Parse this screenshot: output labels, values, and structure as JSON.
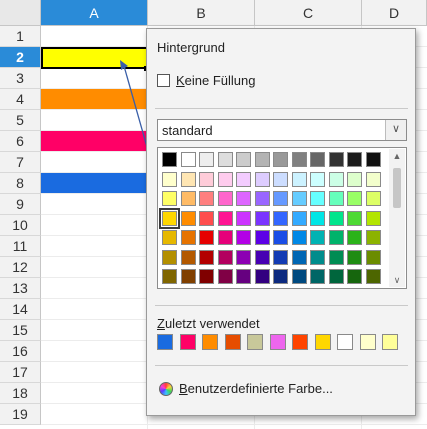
{
  "columns": [
    {
      "label": "A",
      "selected": true
    },
    {
      "label": "B",
      "selected": false
    },
    {
      "label": "C",
      "selected": false
    },
    {
      "label": "D",
      "selected": false
    }
  ],
  "rows": [
    "1",
    "2",
    "3",
    "4",
    "5",
    "6",
    "7",
    "8",
    "9",
    "10",
    "11",
    "12",
    "13",
    "14",
    "15",
    "16",
    "17",
    "18",
    "19"
  ],
  "selected_row": "2",
  "cell_fills": [
    {
      "row": "2",
      "color": "#ffff00"
    },
    {
      "row": "4",
      "color": "#ff8c00"
    },
    {
      "row": "6",
      "color": "#ff0066"
    },
    {
      "row": "8",
      "color": "#1a6be0"
    }
  ],
  "popup": {
    "title": "Hintergrund",
    "no_fill": {
      "accesskey": "K",
      "rest": "eine Füllung"
    },
    "palette_name": "standard",
    "palette_colors": [
      [
        "#000000",
        "#ffffff",
        "#eeeeee",
        "#dddddd",
        "#cccccc",
        "#b3b3b3",
        "#999999",
        "#808080",
        "#666666",
        "#333333",
        "#1c1c1c",
        "#111111"
      ],
      [
        "#ffffcc",
        "#ffe6b3",
        "#ffccd9",
        "#ffccee",
        "#f3ccff",
        "#ddccff",
        "#ccddff",
        "#ccf2ff",
        "#ccffff",
        "#ccffe6",
        "#ddffcc",
        "#f3ffcc"
      ],
      [
        "#ffff66",
        "#ffbb66",
        "#ff7f7f",
        "#ff66cc",
        "#dd66ff",
        "#9966ff",
        "#6699ff",
        "#66ccff",
        "#66ffff",
        "#66ffbb",
        "#99ff66",
        "#ddff66"
      ],
      [
        "#ffd700",
        "#ff8c00",
        "#ff4d4d",
        "#ff1493",
        "#cc33ff",
        "#7a33ff",
        "#3366ff",
        "#33aaff",
        "#00e5e5",
        "#00e58c",
        "#4dd933",
        "#b3e500"
      ],
      [
        "#e6b800",
        "#e67300",
        "#e60000",
        "#e6007a",
        "#b300e6",
        "#5c00e6",
        "#1a4de6",
        "#0088e6",
        "#00b3b3",
        "#00b36b",
        "#2bb31a",
        "#8cb300"
      ],
      [
        "#b38f00",
        "#b35900",
        "#b30000",
        "#b3005f",
        "#8c00b3",
        "#4700b3",
        "#133bb3",
        "#0066b3",
        "#008c8c",
        "#008c53",
        "#1f8c13",
        "#6b8c00"
      ],
      [
        "#806600",
        "#804000",
        "#800000",
        "#800045",
        "#660080",
        "#330080",
        "#0d2a80",
        "#004a80",
        "#006666",
        "#00663d",
        "#16660d",
        "#4d6600"
      ]
    ],
    "recent_label": {
      "accesskey": "Z",
      "rest": "uletzt verwendet"
    },
    "recent_colors": [
      "#1a6be0",
      "#ff0066",
      "#ff8c00",
      "#e64d00",
      "#c8c89a",
      "#ee66ee",
      "#ff4400",
      "#ffd700",
      "#ffffff",
      "#ffffcc",
      "#ffff99"
    ],
    "custom_color": {
      "accesskey": "B",
      "rest": "enutzerdefinierte Farbe..."
    }
  }
}
